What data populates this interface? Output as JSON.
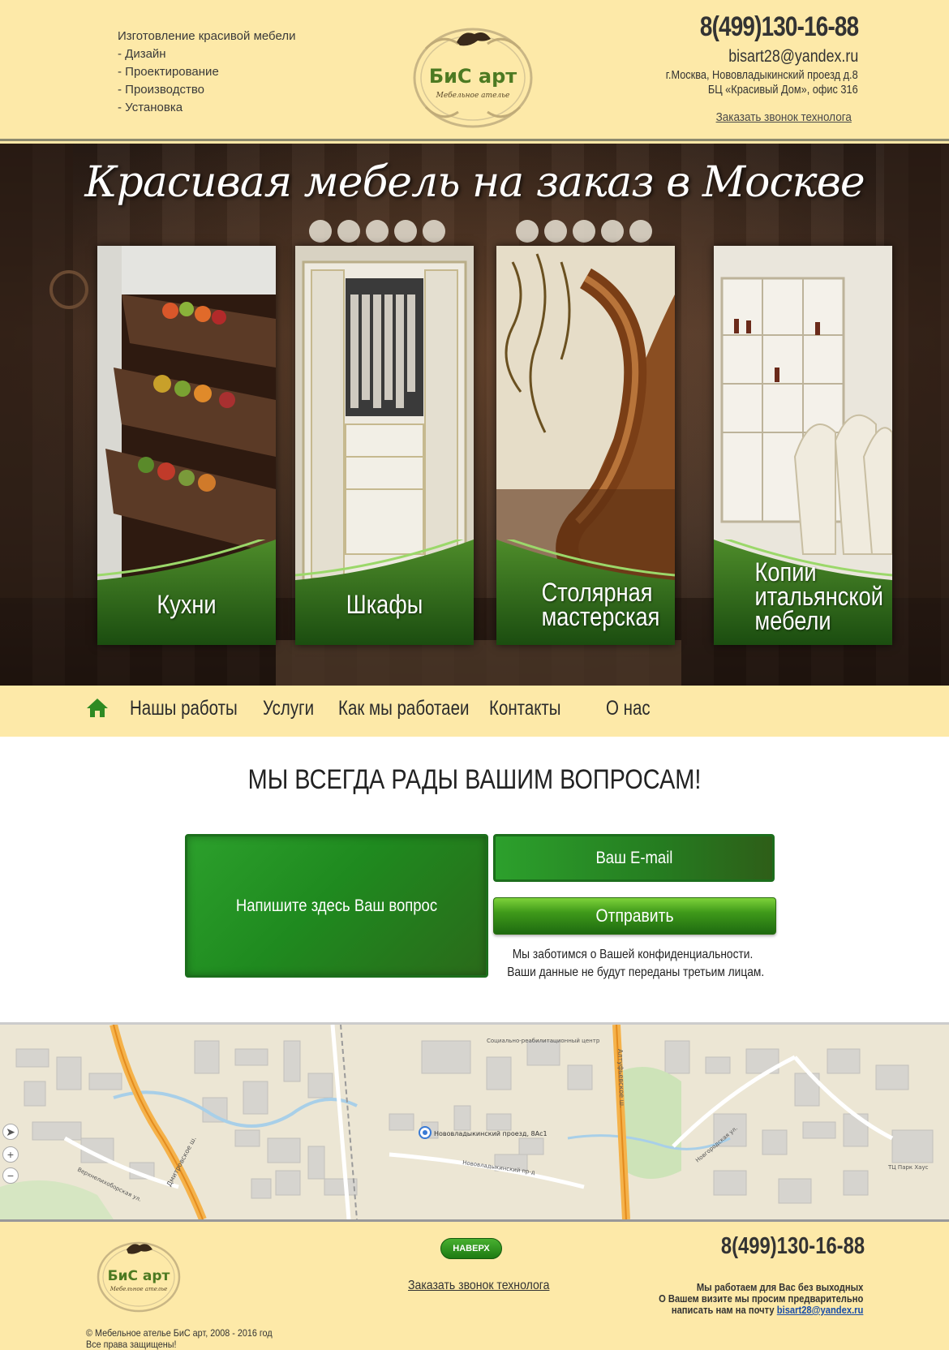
{
  "header": {
    "services_title": "Изготовление красивой мебели",
    "services": [
      "- Дизайн",
      "- Проектирование",
      "- Производство",
      "- Установка"
    ],
    "logo_text": "БиС арт",
    "logo_subtext": "Мебельное ателье",
    "phone": "8(499)130-16-88",
    "email": "bisart28@yandex.ru",
    "address_line1": "г.Москва, Нововладыкинский проезд д.8",
    "address_line2": "БЦ «Красивый Дом», офис 316",
    "callback_link": "Заказать звонок технолога"
  },
  "hero": {
    "title": "Красивая мебель на заказ в Москве",
    "cards": [
      {
        "label": "Кухни",
        "icon": "kitchen-drawers-image"
      },
      {
        "label": "Шкафы",
        "icon": "wardrobe-image"
      },
      {
        "label_line1": "Столярная",
        "label_line2": "мастерская",
        "icon": "staircase-image"
      },
      {
        "label_line1": "Копии",
        "label_line2": "итальянской",
        "label_line3": "мебели",
        "icon": "italian-furniture-image"
      }
    ]
  },
  "nav": {
    "home_icon": "home-icon",
    "items": [
      "Нашы работы",
      "Услуги",
      "Как мы работаеи",
      "Контакты",
      "О нас"
    ]
  },
  "form": {
    "title": "МЫ ВСЕГДА РАДЫ ВАШИМ ВОПРОСАМ!",
    "question_placeholder": "Напишите здесь Ваш вопрос",
    "email_placeholder": "Ваш E-mail",
    "submit_label": "Отправить",
    "privacy_line1": "Мы заботимся о Вашей конфиденциальности.",
    "privacy_line2": "Ваши данные не будут переданы третьим лицам."
  },
  "map": {
    "marker_label": "Нововладыкинский проезд, 8Ас1",
    "streets": [
      "Дмитровское ш.",
      "Алтуфьевское ш.",
      "Нововладыкинский пр-д",
      "Верхнелихоборская ул.",
      "Новгородская ул.",
      "ТЦ Парк Хаус",
      "Социально-реабилитационный центр"
    ],
    "controls": [
      "locate-icon",
      "zoom-in-icon",
      "zoom-out-icon"
    ]
  },
  "footer": {
    "logo_text": "БиС арт",
    "logo_subtext": "Мебельное ателье",
    "top_button": "НАВЕРХ",
    "callback_link": "Заказать звонок технолога",
    "phone": "8(499)130-16-88",
    "info_line1": "Мы работаем для Вас без выходных",
    "info_line2": "О Вашем визите мы просим предварительно",
    "info_line3": "написать нам на почту ",
    "email": "bisart28@yandex.ru",
    "copyright_line1": "© Мебельное ателье БиС арт, 2008 - 2016 год",
    "copyright_line2": "Все права защищены!"
  },
  "colors": {
    "background": "#fde9a8",
    "accent_green": "#2ca02c",
    "dark_green": "#1c6e1c",
    "hero_dark": "#3b2a20"
  }
}
